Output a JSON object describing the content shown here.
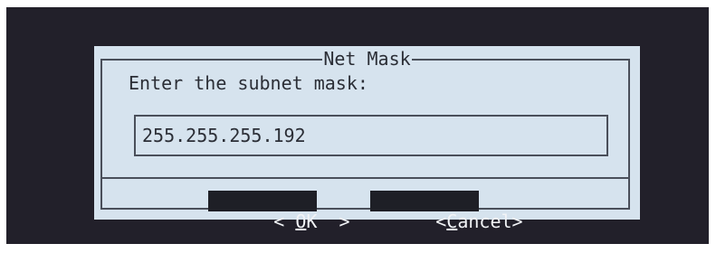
{
  "dialog": {
    "title": "Net Mask",
    "prompt": "Enter the subnet mask:",
    "input_value": "255.255.255.192"
  },
  "buttons": {
    "ok_left": "< ",
    "ok_hotkey": "O",
    "ok_rest": "K  >",
    "cancel_left": "<",
    "cancel_hotkey": "C",
    "cancel_rest": "ancel>"
  },
  "colors": {
    "terminal_background": "#22202a",
    "dialog_background": "#d6e3ee",
    "button_background": "#1e1f26",
    "text": "#2b2e36"
  }
}
